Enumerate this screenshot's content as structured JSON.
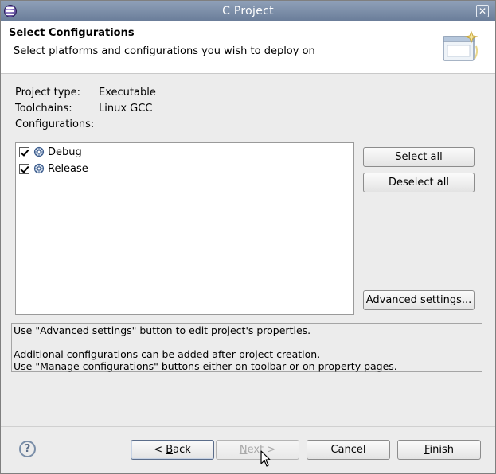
{
  "window": {
    "title": "C Project"
  },
  "banner": {
    "title": "Select Configurations",
    "description": "Select platforms and configurations you wish to deploy on"
  },
  "info": {
    "project_type_label": "Project type:",
    "project_type_value": "Executable",
    "toolchains_label": "Toolchains:",
    "toolchains_value": "Linux GCC",
    "configurations_label": "Configurations:"
  },
  "configurations": [
    {
      "label": "Debug",
      "checked": true
    },
    {
      "label": "Release",
      "checked": true
    }
  ],
  "side_buttons": {
    "select_all": "Select all",
    "deselect_all": "Deselect all",
    "advanced_settings": "Advanced settings..."
  },
  "message": {
    "line1": "Use \"Advanced settings\" button to edit project's properties.",
    "line2": "",
    "line3": "Additional configurations can be added after project creation.",
    "line4": "Use \"Manage configurations\" buttons either on toolbar or on property pages."
  },
  "footer": {
    "help": "?",
    "back_pre": "< ",
    "back_mnemonic": "B",
    "back_post": "ack",
    "next_mnemonic": "N",
    "next_post": "ext >",
    "cancel": "Cancel",
    "finish_mnemonic": "F",
    "finish_post": "inish"
  },
  "icons": {
    "app": "eclipse-icon",
    "close": "close-icon",
    "wizard": "wizard-banner-icon",
    "configuration": "gear-config-icon"
  },
  "colors": {
    "titlebar": "#7b8ca8",
    "window_bg": "#ececec",
    "disabled_text": "#a8a8a8"
  }
}
